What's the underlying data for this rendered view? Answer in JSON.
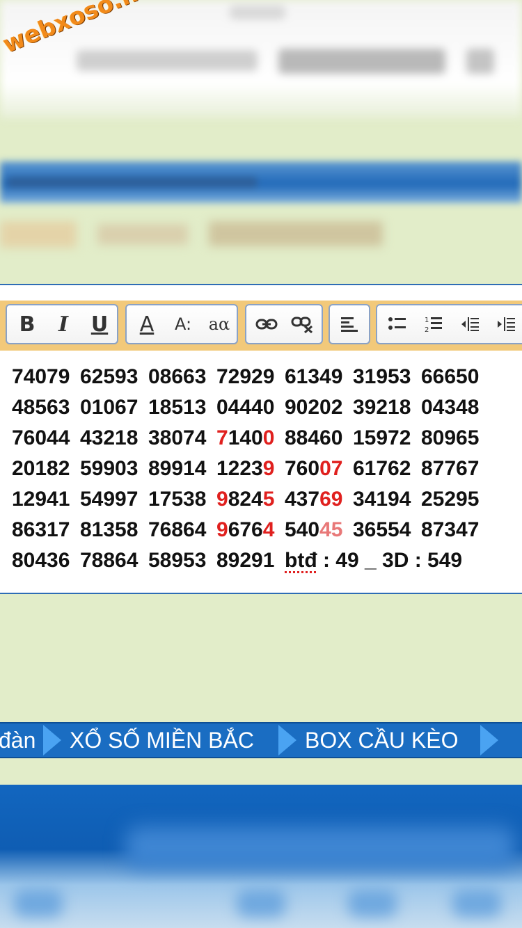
{
  "watermark": "webxoso.net",
  "editor": {
    "toolbar": {
      "bold_label": "B",
      "italic_label": "I",
      "underline_label": "U",
      "font_color_label": "A",
      "font_size_label": "A:",
      "case_label": "aα"
    },
    "rows": [
      {
        "groups": [
          "74079",
          "62593",
          "08663",
          "72929",
          "61349",
          "31953",
          "66650"
        ]
      },
      {
        "groups": [
          "48563",
          "01067",
          "18513",
          "04440",
          "90202",
          "39218",
          "04348"
        ]
      },
      {
        "groups": [
          "76044",
          "43218",
          "38074",
          "71400",
          "88460",
          "15972",
          "80965"
        ]
      },
      {
        "groups": [
          "20182",
          "59903",
          "89914",
          "12239",
          "76007",
          "61762",
          "87767"
        ]
      },
      {
        "groups": [
          "12941",
          "54997",
          "17538",
          "98245",
          "43769",
          "34194",
          "25295"
        ]
      },
      {
        "groups": [
          "86317",
          "81358",
          "76864",
          "96764",
          "54045",
          "36554",
          "87347"
        ]
      },
      {
        "groups": [
          "80436",
          "78864",
          "58953",
          "89291"
        ],
        "note_btd": "btđ",
        "note_rest": " : 49 _ 3D : 549"
      }
    ],
    "highlight_color": "#e0201e"
  },
  "nav": {
    "items": [
      "đàn",
      "XỔ SỐ MIỀN BẮC",
      "BOX CẦU KÈO"
    ],
    "bg_color": "#1a6dc2",
    "arrow_color": "#4aa3f2"
  }
}
